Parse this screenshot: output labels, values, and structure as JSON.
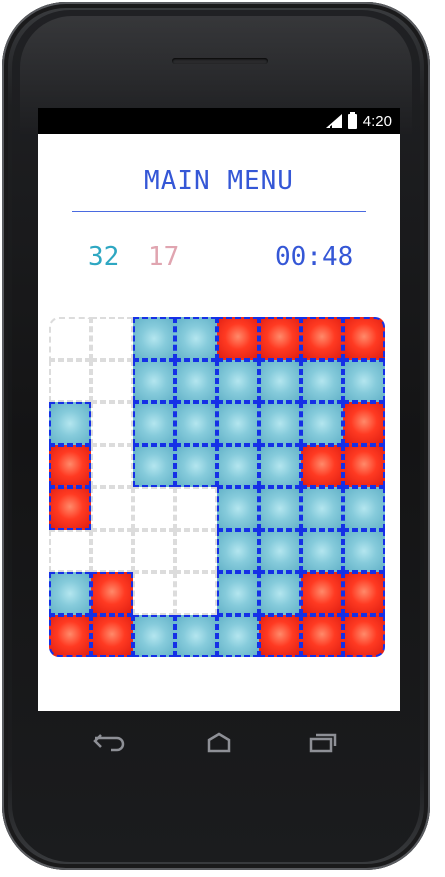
{
  "status": {
    "time": "4:20",
    "signal_icon": "signal-icon",
    "battery_icon": "battery-icon"
  },
  "header": {
    "title": "MAIN MENU"
  },
  "stats": {
    "blue_count": "32",
    "red_count": "17",
    "timer": "00:48"
  },
  "colors": {
    "accent": "#3557d6",
    "blue_tile": "#86cbdb",
    "red_tile": "#ff3a22",
    "grid_border": "#1530e6"
  },
  "board": {
    "cols": 8,
    "rows": 8,
    "cells": [
      [
        "w",
        "w",
        "b",
        "b",
        "r",
        "r",
        "r",
        "r"
      ],
      [
        "w",
        "w",
        "b",
        "b",
        "b",
        "b",
        "b",
        "b"
      ],
      [
        "b",
        "w",
        "b",
        "b",
        "b",
        "b",
        "b",
        "r"
      ],
      [
        "r",
        "w",
        "b",
        "b",
        "b",
        "b",
        "r",
        "r"
      ],
      [
        "r",
        "w",
        "w",
        "w",
        "b",
        "b",
        "b",
        "b"
      ],
      [
        "w",
        "w",
        "w",
        "w",
        "b",
        "b",
        "b",
        "b"
      ],
      [
        "b",
        "r",
        "w",
        "w",
        "b",
        "b",
        "r",
        "r"
      ],
      [
        "r",
        "r",
        "b",
        "b",
        "b",
        "r",
        "r",
        "r"
      ]
    ]
  },
  "navbar": {
    "back_icon": "back-icon",
    "home_icon": "home-icon",
    "recents_icon": "recents-icon"
  }
}
